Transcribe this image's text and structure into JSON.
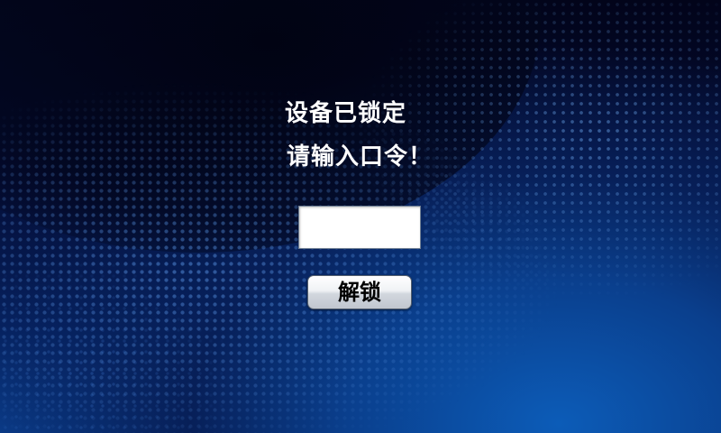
{
  "lock_screen": {
    "title": "设备已锁定",
    "prompt": "请输入口令！",
    "password_value": "",
    "password_placeholder": "",
    "unlock_label": "解锁"
  },
  "colors": {
    "background_dark": "#02041a",
    "background_blue": "#0a3f8d",
    "text": "#ffffff",
    "button_text": "#000000"
  }
}
